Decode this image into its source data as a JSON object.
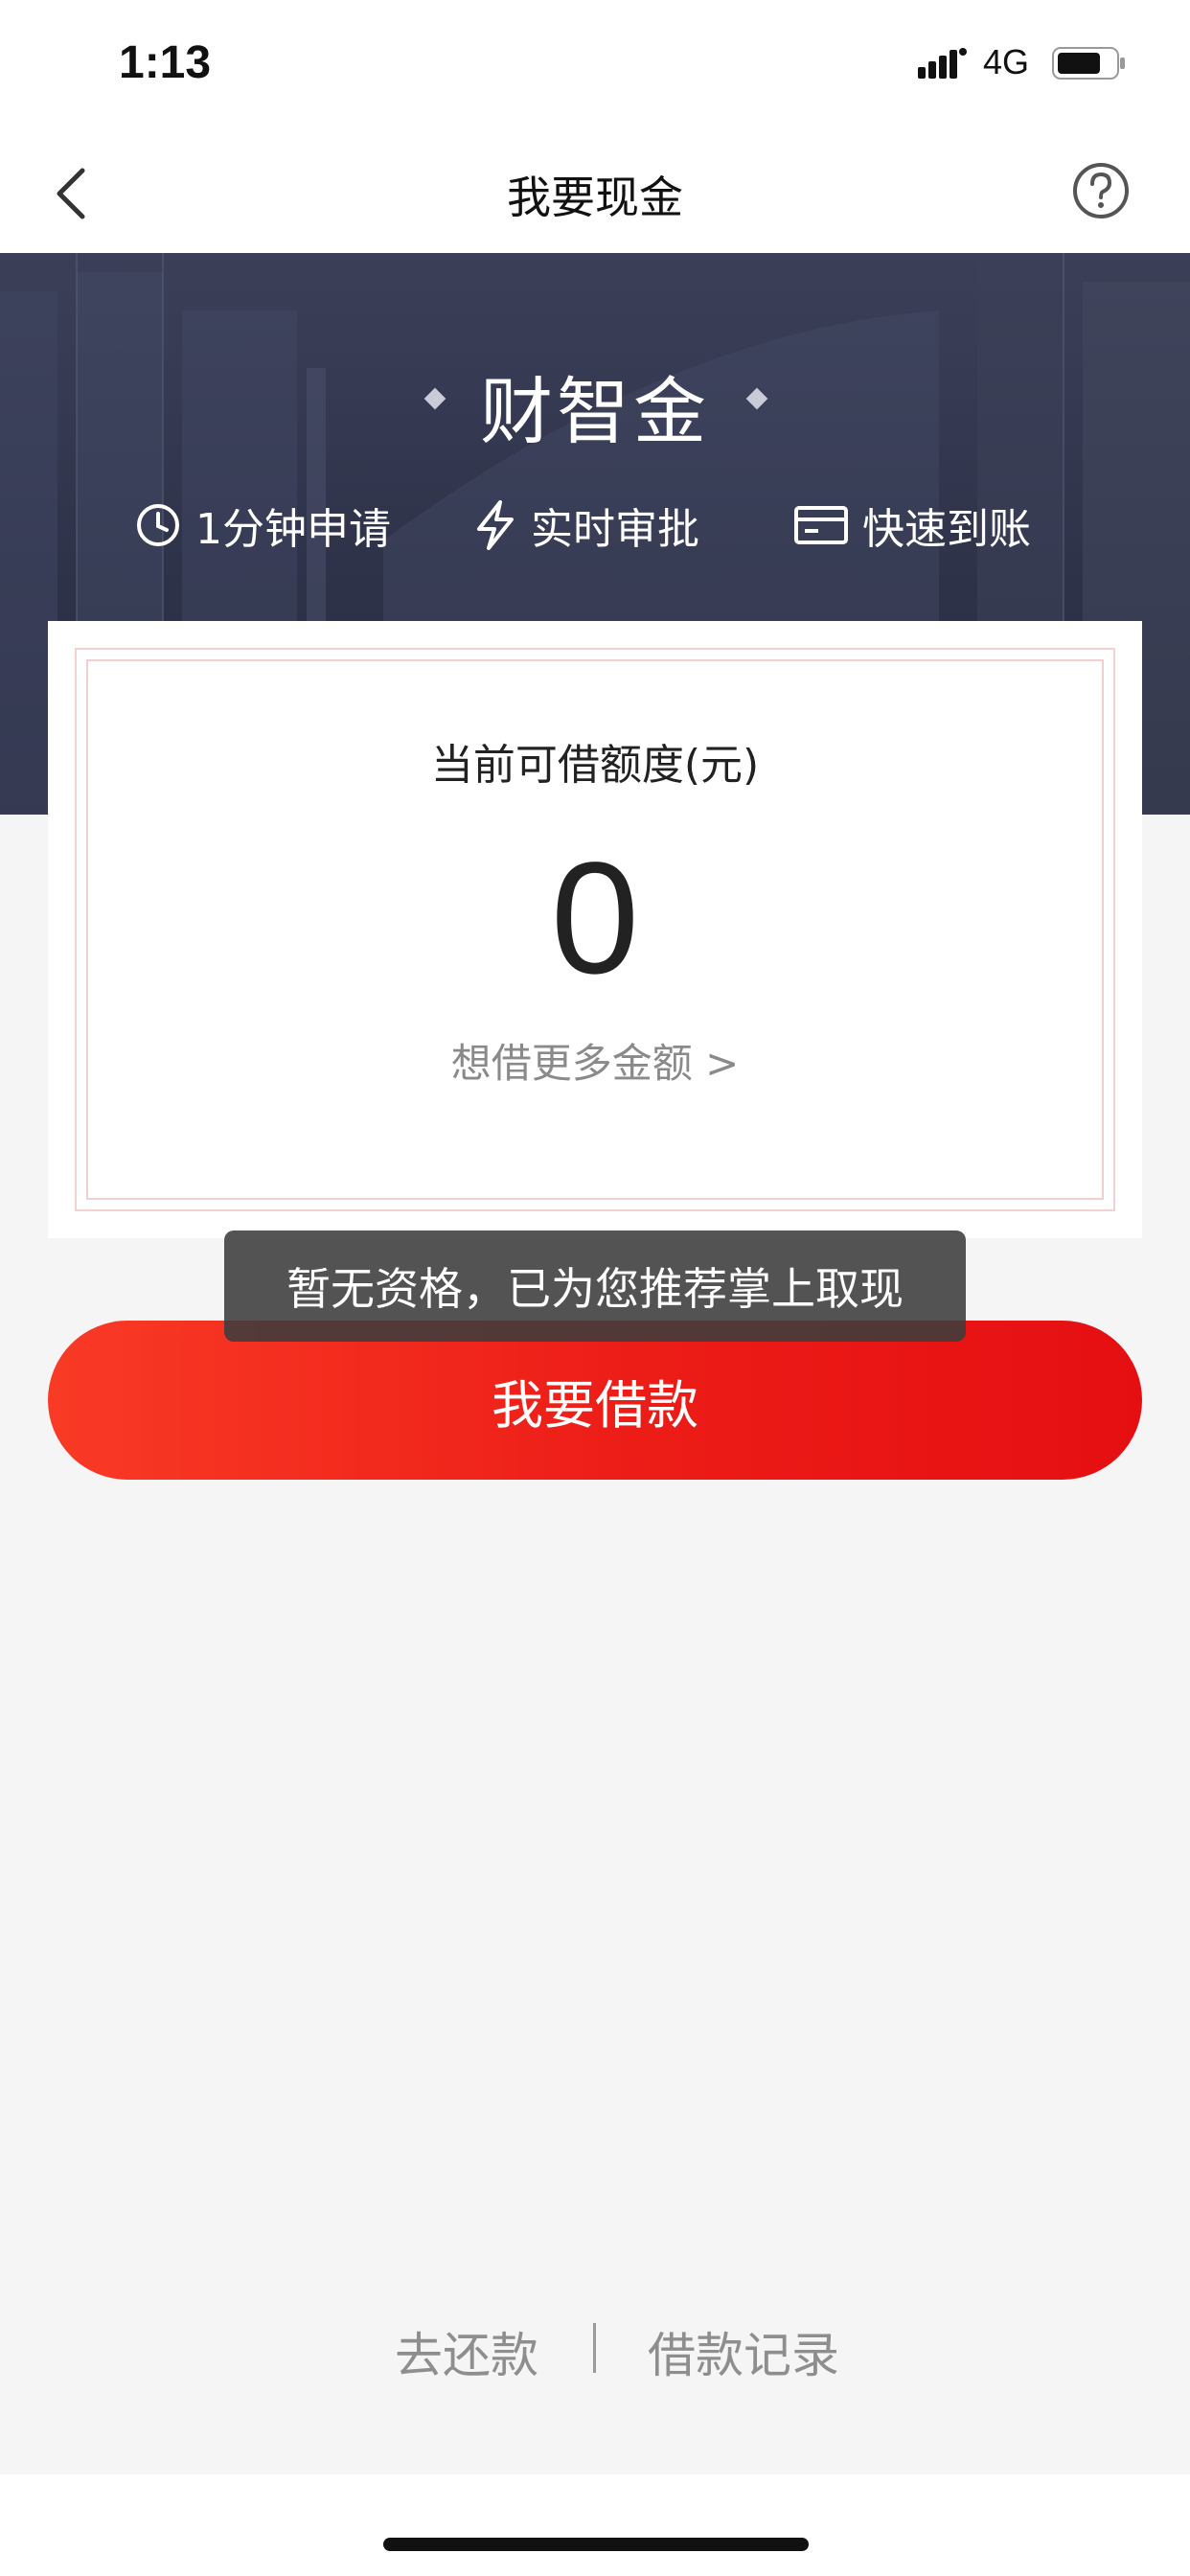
{
  "status_bar": {
    "time": "1:13",
    "network": "4G"
  },
  "nav": {
    "title": "我要现金",
    "back_icon": "chevron-left-icon",
    "help_icon": "question-circle-icon"
  },
  "banner": {
    "brand": "财智金",
    "features": [
      {
        "icon": "clock-icon",
        "label": "1分钟申请"
      },
      {
        "icon": "lightning-icon",
        "label": "实时审批"
      },
      {
        "icon": "card-icon",
        "label": "快速到账"
      }
    ]
  },
  "quota_card": {
    "label": "当前可借额度(元)",
    "value": "0",
    "more_link": "想借更多金额 >"
  },
  "toast": {
    "message": "暂无资格，已为您推荐掌上取现"
  },
  "primary_button": {
    "label": "我要借款"
  },
  "footer": {
    "repay_link": "去还款",
    "records_link": "借款记录"
  },
  "colors": {
    "accent_red": "#e50f12",
    "banner_dark": "#2f334a",
    "page_bg": "#f5f5f5"
  }
}
